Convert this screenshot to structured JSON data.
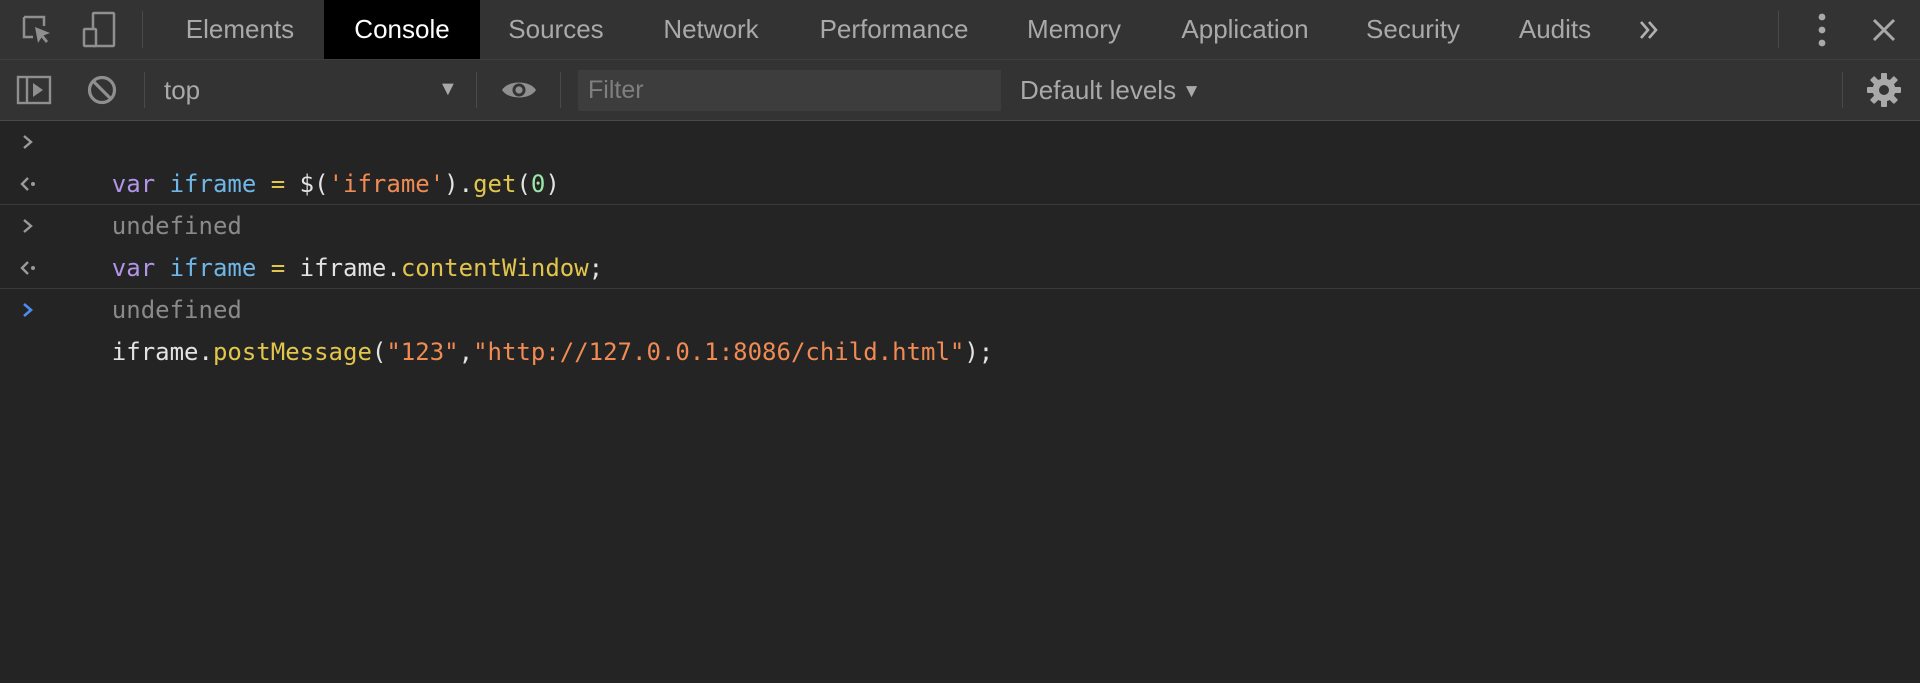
{
  "tabs": [
    {
      "label": "Elements",
      "active": false
    },
    {
      "label": "Console",
      "active": true
    },
    {
      "label": "Sources",
      "active": false
    },
    {
      "label": "Network",
      "active": false
    },
    {
      "label": "Performance",
      "active": false
    },
    {
      "label": "Memory",
      "active": false
    },
    {
      "label": "Application",
      "active": false
    },
    {
      "label": "Security",
      "active": false
    },
    {
      "label": "Audits",
      "active": false
    }
  ],
  "icons": {
    "inspect": "inspect-element-icon",
    "device": "device-toolbar-icon",
    "more_tabs": "chevron-double-right-icon",
    "menu": "vertical-ellipsis-icon",
    "close": "close-icon",
    "sidebar": "sidebar-toggle-icon",
    "clear": "clear-console-icon",
    "eye": "eye-icon",
    "settings": "gear-icon"
  },
  "toolbar": {
    "context": "top",
    "filter_placeholder": "Filter",
    "filter_value": "",
    "levels_label": "Default levels"
  },
  "console": {
    "line1": {
      "kw": "var",
      "name": "iframe",
      "eq": "=",
      "dollar": "$(",
      "str": "'iframe'",
      "close": ").",
      "fn": "get",
      "paren_open": "(",
      "num": "0",
      "paren_close": ")"
    },
    "result1": "undefined",
    "line2": {
      "kw": "var",
      "name": "iframe",
      "eq": "=",
      "obj": "iframe.",
      "prop": "contentWindow",
      "semi": ";"
    },
    "result2": "undefined",
    "prompt": {
      "obj": "iframe.",
      "fn": "postMessage",
      "open": "(",
      "arg1": "\"123\"",
      "comma": ",",
      "arg2": "\"http://127.0.0.1:8086/child.html\"",
      "close": ");"
    }
  },
  "colors": {
    "background": "#242424",
    "toolbar": "#333333",
    "active_tab": "#000000",
    "prompt_accent": "#4d8cf0"
  }
}
